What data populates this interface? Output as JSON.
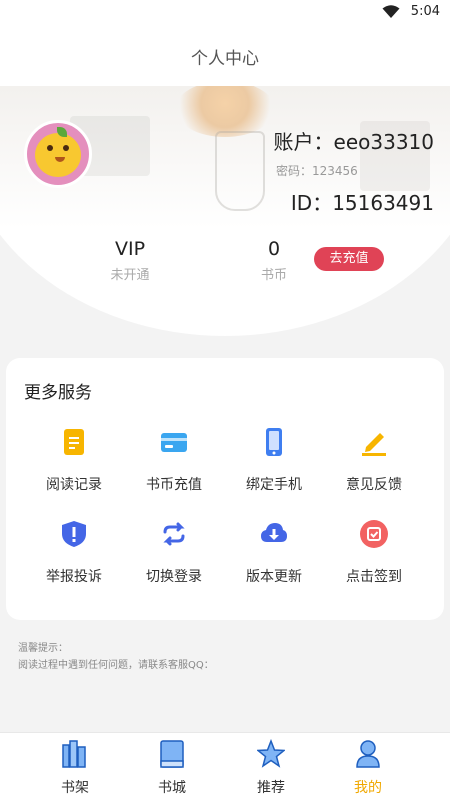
{
  "status_bar": {
    "time": "5:04"
  },
  "header": {
    "title": "个人中心"
  },
  "profile": {
    "account_name": "账户：eeo33310",
    "password_text": "密码：123456",
    "id_text": "ID：15163491",
    "vip_value": "VIP",
    "vip_label": "未开通",
    "coin_value": "0",
    "coin_label": "书币",
    "recharge_label": "去充值"
  },
  "services": {
    "title": "更多服务",
    "items": [
      {
        "label": "阅读记录",
        "icon": "reading-record-icon",
        "color": "#f7b500"
      },
      {
        "label": "书币充值",
        "icon": "card-recharge-icon",
        "color": "#3aa6f0"
      },
      {
        "label": "绑定手机",
        "icon": "phone-icon",
        "color": "#3f7ef0"
      },
      {
        "label": "意见反馈",
        "icon": "pencil-icon",
        "color": "#f7b500"
      },
      {
        "label": "举报投诉",
        "icon": "shield-icon",
        "color": "#4466e6"
      },
      {
        "label": "切换登录",
        "icon": "switch-icon",
        "color": "#4466e6"
      },
      {
        "label": "版本更新",
        "icon": "cloud-download-icon",
        "color": "#4466e6"
      },
      {
        "label": "点击签到",
        "icon": "calendar-check-icon",
        "color": "#f26262"
      }
    ]
  },
  "tips": {
    "title": "温馨提示：",
    "text": "阅读过程中遇到任何问题，请联系客服QQ："
  },
  "tabs": [
    {
      "label": "书架",
      "icon": "bookshelf-icon"
    },
    {
      "label": "书城",
      "icon": "book-icon"
    },
    {
      "label": "推荐",
      "icon": "star-icon"
    },
    {
      "label": "我的",
      "icon": "user-icon",
      "active": true
    }
  ],
  "colors": {
    "accent": "#f0a800",
    "recharge": "#e04356",
    "tab_blue": "#3f8ef0"
  }
}
